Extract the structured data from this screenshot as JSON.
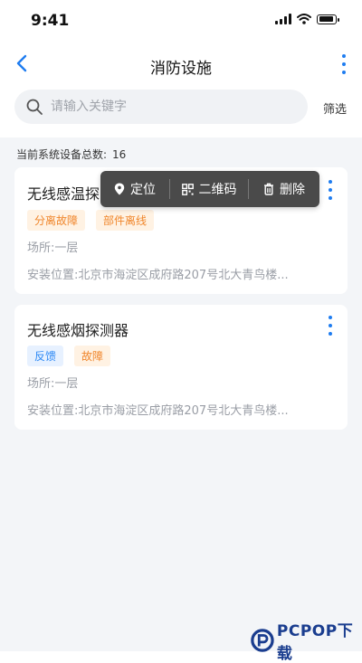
{
  "status_bar": {
    "time": "9:41"
  },
  "nav": {
    "title": "消防设施",
    "back_icon": "chevron-left-icon",
    "more_icon": "more-vertical-icon"
  },
  "search": {
    "placeholder": "请输入关键字",
    "value": "",
    "filter_label": "筛选"
  },
  "summary": {
    "label": "当前系统设备总数:",
    "count": "16"
  },
  "popup_menu": {
    "locate": "定位",
    "qrcode": "二维码",
    "delete": "删除"
  },
  "devices": [
    {
      "name": "无线感温探",
      "tags": [
        "分离故障",
        "部件离线"
      ],
      "place": "场所:一层",
      "address": "安装位置:北京市海淀区成府路207号北大青鸟楼..."
    },
    {
      "name": "无线感烟探测器",
      "tags": [
        "反馈",
        "故障"
      ],
      "place": "场所:一层",
      "address": "安装位置:北京市海淀区成府路207号北大青鸟楼..."
    }
  ],
  "colors": {
    "accent": "#1e7cf0",
    "tag_orange": "#f0862b",
    "tag_blue": "#2f8af5",
    "popup_bg": "#4a4a4a"
  },
  "watermark": {
    "text": "PCPOP下载"
  }
}
